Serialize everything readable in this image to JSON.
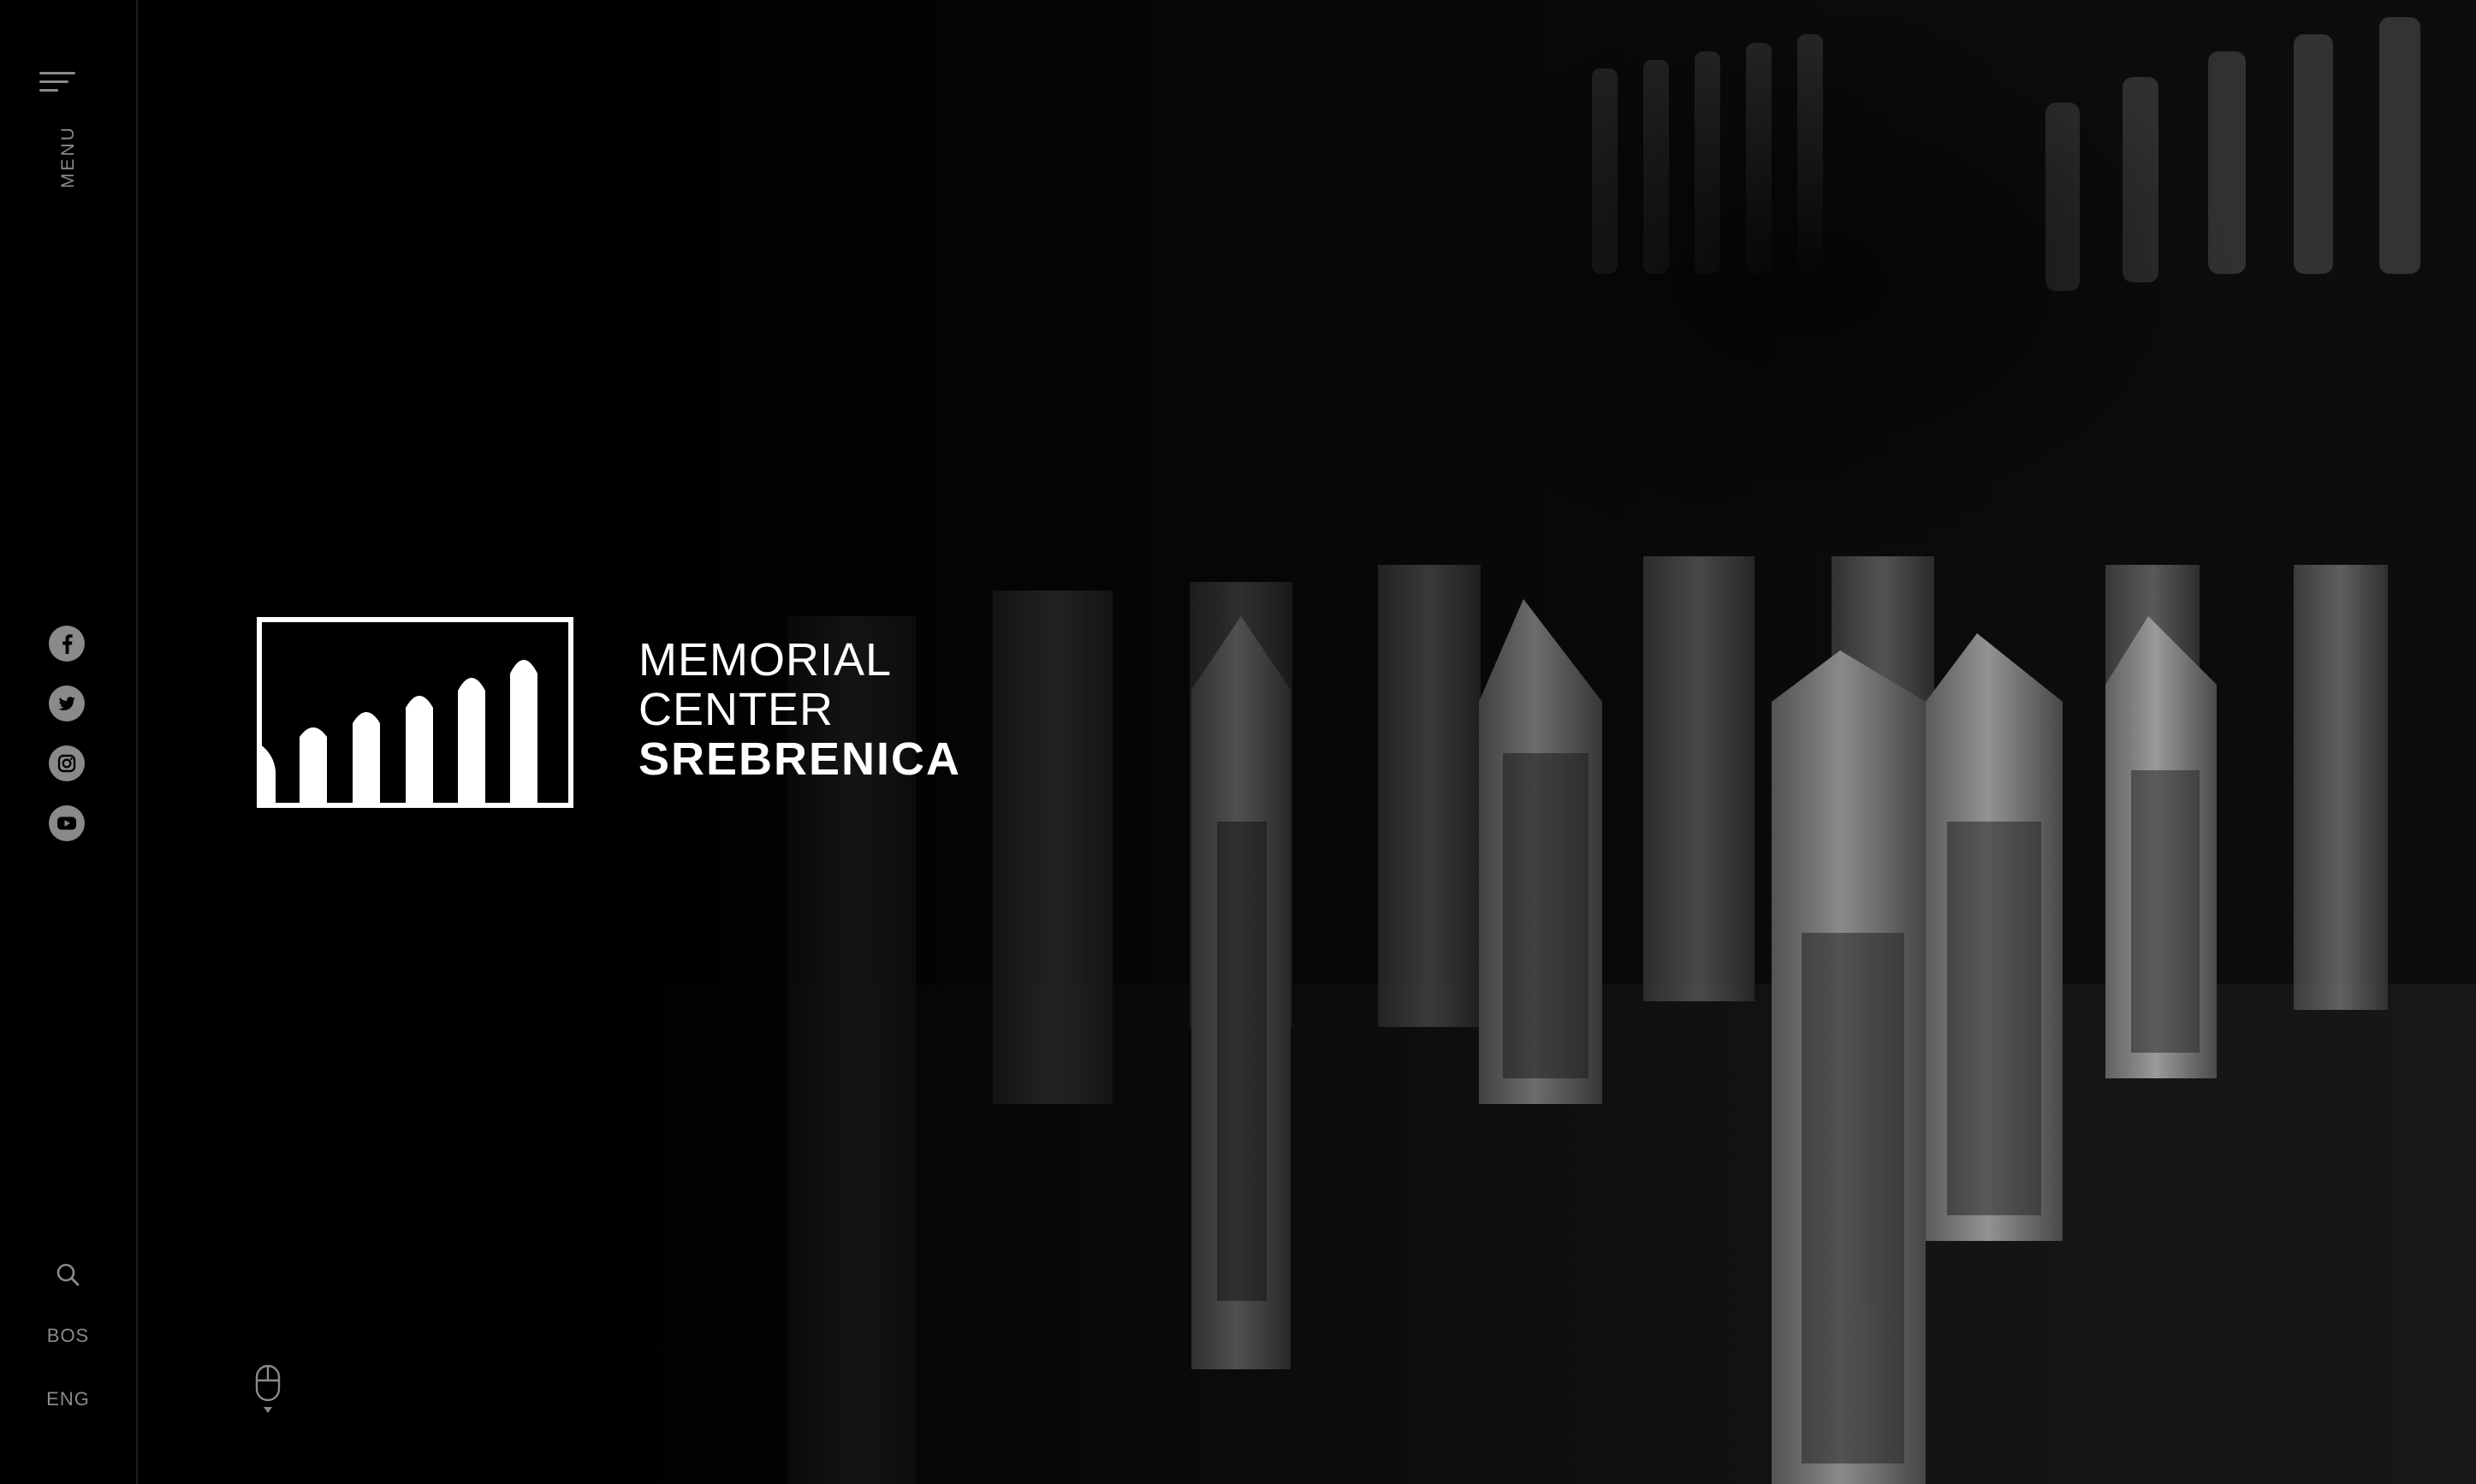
{
  "rail": {
    "menu_label": "MENU",
    "social": [
      {
        "name": "facebook-icon"
      },
      {
        "name": "twitter-icon"
      },
      {
        "name": "instagram-icon"
      },
      {
        "name": "youtube-icon"
      }
    ],
    "languages": [
      "BOS",
      "ENG"
    ]
  },
  "logo": {
    "line1": "MEMORIAL",
    "line2": "CENTER",
    "line3": "SREBRENICA"
  },
  "colors": {
    "background": "#000000",
    "rail_icon": "#8a8a8a",
    "logo": "#ffffff"
  },
  "icons": {
    "menu": "hamburger-menu-icon",
    "search": "search-icon",
    "scroll": "mouse-scroll-icon"
  }
}
